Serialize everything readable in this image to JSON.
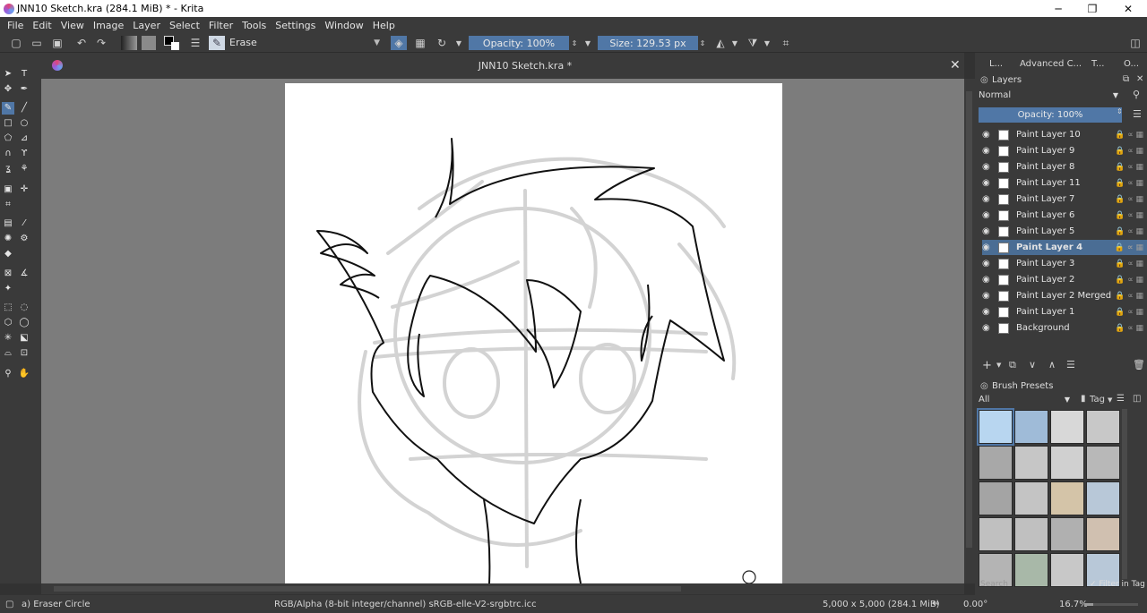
{
  "window": {
    "title": "JNN10 Sketch.kra (284.1 MiB)  * - Krita",
    "minimize": "─",
    "maximize": "❐",
    "close": "✕"
  },
  "menu": [
    "File",
    "Edit",
    "View",
    "Image",
    "Layer",
    "Select",
    "Filter",
    "Tools",
    "Settings",
    "Window",
    "Help"
  ],
  "toolbar": {
    "brush_preset": "Erase",
    "opacity_label": "Opacity: 100%",
    "size_label": "Size: 129.53 px"
  },
  "document": {
    "tab_title": "JNN10 Sketch.kra *"
  },
  "dock": {
    "tabs": [
      "L...",
      "Advanced C...",
      "T...",
      "O..."
    ],
    "layers_title": "Layers",
    "blend_mode": "Normal",
    "opacity": "Opacity:  100%",
    "layers": [
      "Paint Layer 10",
      "Paint Layer 9",
      "Paint Layer 8",
      "Paint Layer 11",
      "Paint Layer 7",
      "Paint Layer 6",
      "Paint Layer 5",
      "Paint Layer 4",
      "Paint Layer 3",
      "Paint Layer 2",
      "Paint Layer 2 Merged",
      "Paint Layer 1",
      "Background"
    ],
    "selected_layer": "Paint Layer 4",
    "brush_presets_title": "Brush Presets",
    "brush_filter": "All",
    "tag_label": "Tag",
    "search_placeholder": "Search",
    "filter_in_tag": "Filter in Tag"
  },
  "status": {
    "tool": "a) Eraser Circle",
    "color_space": "RGB/Alpha (8-bit integer/channel)  sRGB-elle-V2-srgbtrc.icc",
    "image_size": "5,000 x 5,000 (284.1 MiB)",
    "rotation": "0.00°",
    "zoom": "16.7%"
  },
  "colors": {
    "accent": "#5077a6",
    "selection": "#4a6d94",
    "panel": "#3a3a3a",
    "canvas_bg": "#7c7c7c"
  }
}
